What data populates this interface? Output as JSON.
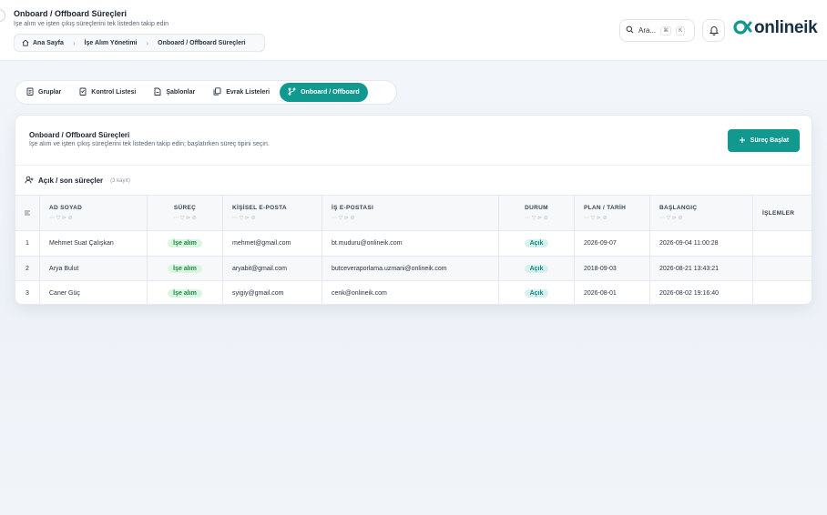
{
  "header": {
    "title": "Onboard / Offboard Süreçleri",
    "subtitle": "İşe alım ve işten çıkış süreçlerini tek listeden takip edin",
    "breadcrumb": [
      "Ana Sayfa",
      "İşe Alım Yönetimi",
      "Onboard / Offboard Süreçleri"
    ],
    "search_label": "Ara...",
    "shortcut_cmd": "⌘",
    "shortcut_key": "K",
    "logo_text": "onlineik"
  },
  "tabs": [
    {
      "label": "Gruplar",
      "icon": "clipboard-icon"
    },
    {
      "label": "Kontrol Listesi",
      "icon": "checklist-icon"
    },
    {
      "label": "Şablonlar",
      "icon": "template-icon"
    },
    {
      "label": "Evrak Listeleri",
      "icon": "documents-icon"
    },
    {
      "label": "Onboard / Offboard",
      "icon": "branch-icon",
      "active": true
    }
  ],
  "card": {
    "title": "Onboard / Offboard Süreçleri",
    "subtitle": "İşe alım ve işten çıkış süreçlerini tek listeden takip edin; başlatırken süreç tipini seçin.",
    "start_button": "Süreç Başlat",
    "list_title": "Açık / son süreçler",
    "list_count": "(3 kayıt)"
  },
  "table": {
    "columns": [
      "",
      "AD SOYAD",
      "SÜREÇ",
      "KİŞİSEL E-POSTA",
      "İŞ E-POSTASI",
      "DURUM",
      "PLAN / TARİH",
      "BAŞLANGIÇ",
      "İŞLEMLER"
    ],
    "rows": [
      {
        "no": "1",
        "name": "Mehmet Suat Çalışkan",
        "process": "İşe alım",
        "personal_email": "mehmet@gmail.com",
        "work_email": "bt.muduru@onlineik.com",
        "status": "Açık",
        "plan_date": "2026-09-07",
        "start": "2026-09-04 11:00:28"
      },
      {
        "no": "2",
        "name": "Arya Bulut",
        "process": "İşe alım",
        "personal_email": "aryabit@gmail.com",
        "work_email": "butceveraporlama.uzmani@onlineik.com",
        "status": "Açık",
        "plan_date": "2018-09-03",
        "start": "2026-08-21 13:43:21"
      },
      {
        "no": "3",
        "name": "Caner Güç",
        "process": "İşe alım",
        "personal_email": "syigiy@gmail.com",
        "work_email": "cenk@onlineik.com",
        "status": "Açık",
        "plan_date": "2026-08-01",
        "start": "2026-08-02 19:16:40"
      }
    ]
  },
  "colors": {
    "accent": "#12998f",
    "badge_green": "#dcf5e3",
    "badge_teal": "#d8f1ee"
  }
}
